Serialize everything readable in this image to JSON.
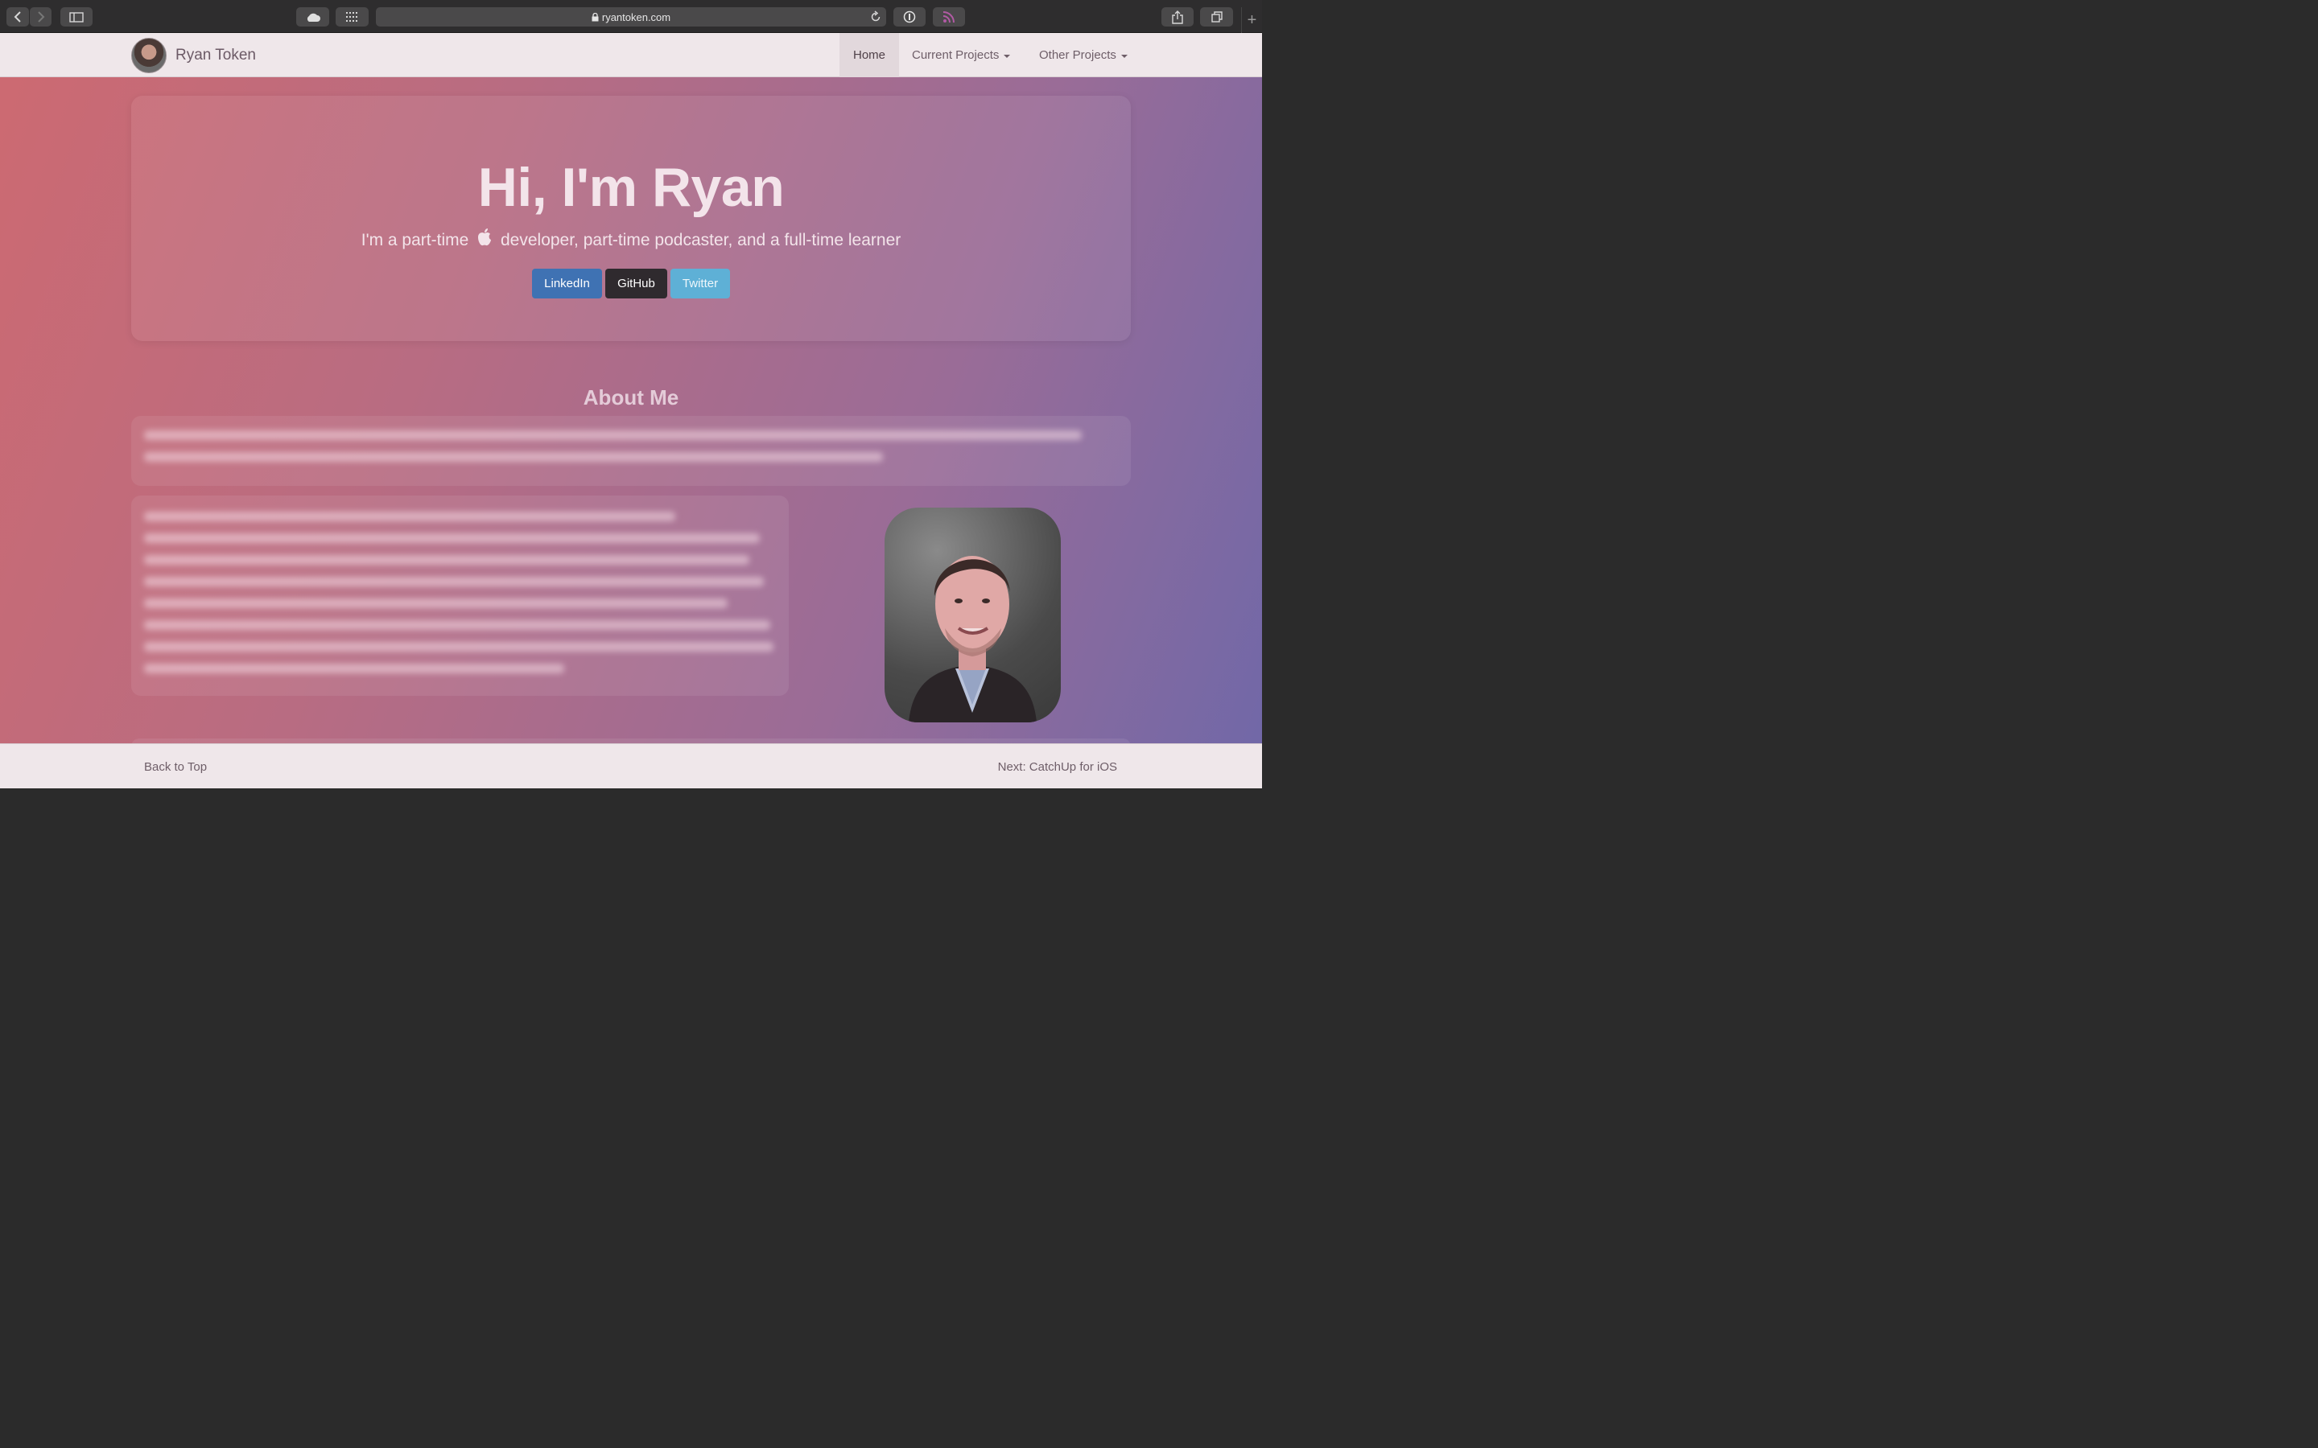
{
  "browser": {
    "url": "ryantoken.com",
    "icons": [
      "back-icon",
      "forward-icon",
      "sidebar-icon",
      "icloud-icon",
      "grid-icon",
      "lock-icon",
      "reload-icon",
      "password-icon",
      "rss-icon",
      "share-icon",
      "tabs-icon",
      "new-tab-icon"
    ]
  },
  "navbar": {
    "brand": "Ryan Token",
    "items": [
      {
        "label": "Home"
      },
      {
        "label": "Current Projects"
      },
      {
        "label": "Other Projects"
      }
    ]
  },
  "hero": {
    "title": "Hi, I'm Ryan",
    "subtitle_before": "I'm a part-time",
    "subtitle_after": "developer, part-time podcaster, and a full-time learner",
    "buttons": {
      "linkedin": "LinkedIn",
      "github": "GitHub",
      "twitter": "Twitter"
    },
    "colors": {
      "linkedin": "#3f72b3",
      "github": "#2f2a2e",
      "twitter": "#5eb0d6"
    }
  },
  "about": {
    "title": "About Me"
  },
  "footer": {
    "back_to_top": "Back to Top",
    "next": "Next: CatchUp for iOS"
  }
}
